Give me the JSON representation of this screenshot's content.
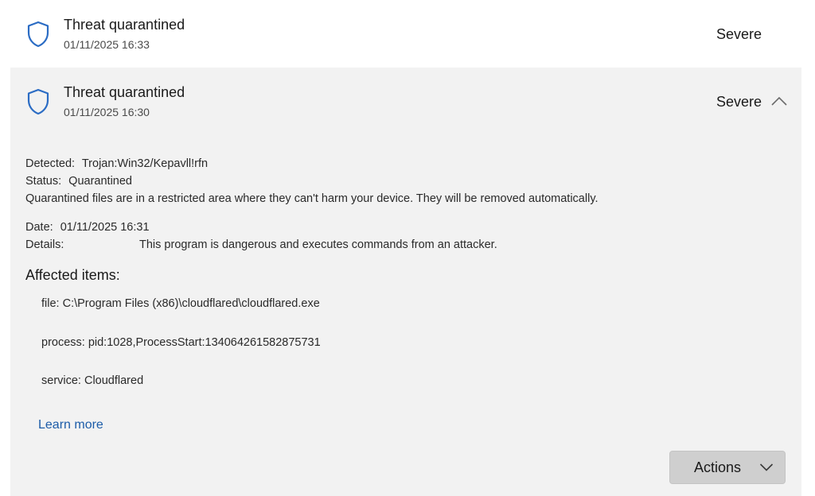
{
  "threats": [
    {
      "title": "Threat quarantined",
      "time": "01/11/2025 16:33",
      "severity": "Severe",
      "icon": "shield-icon"
    },
    {
      "title": "Threat quarantined",
      "time": "01/11/2025 16:30",
      "severity": "Severe",
      "icon": "shield-icon",
      "expanded": true,
      "detected_label": "Detected:",
      "detected_value": "Trojan:Win32/Kepavll!rfn",
      "status_label": "Status:",
      "status_value": "Quarantined",
      "status_note": "Quarantined files are in a restricted area where they can't harm your device. They will be removed automatically.",
      "date_label": "Date:",
      "date_value": "01/11/2025 16:31",
      "details_label": "Details:",
      "details_value": "This program is dangerous and executes commands from an attacker.",
      "affected_heading": "Affected items:",
      "affected_items": [
        "file: C:\\Program Files (x86)\\cloudflared\\cloudflared.exe",
        "process: pid:1028,ProcessStart:134064261582875731",
        "service: Cloudflared"
      ],
      "learn_more": "Learn more",
      "actions_label": "Actions"
    }
  ],
  "colors": {
    "shield": "#2b6cc4",
    "link": "#1c5ca8",
    "expanded_bg": "#f2f2f2",
    "button_bg": "#cfcfcf"
  }
}
